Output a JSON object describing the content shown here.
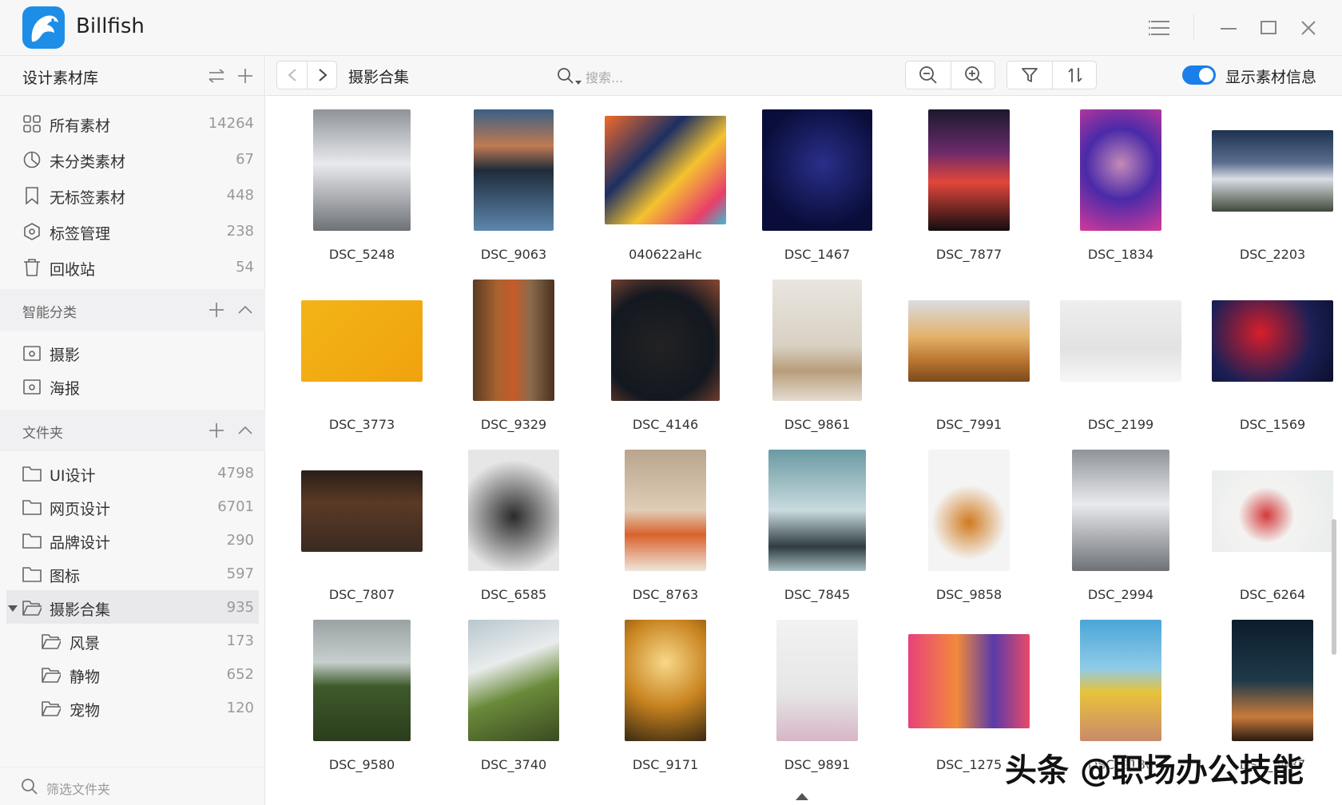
{
  "app": {
    "title": "Billfish"
  },
  "library": {
    "title": "设计素材库"
  },
  "nav_items": [
    {
      "label": "所有素材",
      "count": "14264",
      "icon": "grid-icon"
    },
    {
      "label": "未分类素材",
      "count": "67",
      "icon": "pie-icon"
    },
    {
      "label": "无标签素材",
      "count": "448",
      "icon": "bookmark-icon"
    },
    {
      "label": "标签管理",
      "count": "238",
      "icon": "tag-icon"
    },
    {
      "label": "回收站",
      "count": "54",
      "icon": "trash-icon"
    }
  ],
  "smart_section": {
    "title": "智能分类",
    "items": [
      {
        "label": "摄影"
      },
      {
        "label": "海报"
      }
    ]
  },
  "folder_section": {
    "title": "文件夹",
    "folders": [
      {
        "label": "UI设计",
        "count": "4798"
      },
      {
        "label": "网页设计",
        "count": "6701"
      },
      {
        "label": "品牌设计",
        "count": "290"
      },
      {
        "label": "图标",
        "count": "597"
      },
      {
        "label": "摄影合集",
        "count": "935",
        "active": true
      }
    ],
    "subfolders": [
      {
        "label": "风景",
        "count": "173"
      },
      {
        "label": "静物",
        "count": "652"
      },
      {
        "label": "宠物",
        "count": "120"
      }
    ]
  },
  "filter": {
    "placeholder": "筛选文件夹"
  },
  "toolbar": {
    "breadcrumb": "摄影合集",
    "search_placeholder": "搜索...",
    "show_info_label": "显示素材信息",
    "show_info_on": true
  },
  "colors": {
    "accent": "#1a7fe8",
    "logo": "#1d8ee6"
  },
  "items": [
    {
      "name": "DSC_5248"
    },
    {
      "name": "DSC_9063"
    },
    {
      "name": "040622aHc"
    },
    {
      "name": "DSC_1467"
    },
    {
      "name": "DSC_7877"
    },
    {
      "name": "DSC_1834"
    },
    {
      "name": "DSC_2203"
    },
    {
      "name": "DSC_3773"
    },
    {
      "name": "DSC_9329"
    },
    {
      "name": "DSC_4146"
    },
    {
      "name": "DSC_9861"
    },
    {
      "name": "DSC_7991"
    },
    {
      "name": "DSC_2199"
    },
    {
      "name": "DSC_1569"
    },
    {
      "name": "DSC_7807"
    },
    {
      "name": "DSC_6585"
    },
    {
      "name": "DSC_8763"
    },
    {
      "name": "DSC_7845"
    },
    {
      "name": "DSC_9858"
    },
    {
      "name": "DSC_2994"
    },
    {
      "name": "DSC_6264"
    },
    {
      "name": "DSC_9580"
    },
    {
      "name": "DSC_3740"
    },
    {
      "name": "DSC_9171"
    },
    {
      "name": "DSC_9891"
    },
    {
      "name": "DSC_1275"
    },
    {
      "name": "DSC_2136"
    },
    {
      "name": "DSC_5087"
    }
  ],
  "watermark": "头条 @职场办公技能"
}
